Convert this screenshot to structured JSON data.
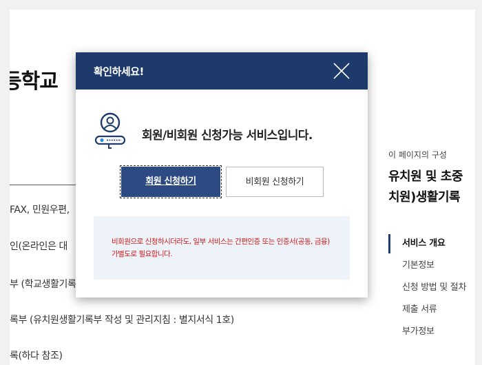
{
  "page": {
    "title": "등학교",
    "content_lines": [
      "FAX, 민원우편,",
      "인(온라인은 대",
      "부 (학교생활기록",
      "록부 (유치원생활기록부 작성 및 관리지침 : 별지서식 1호)",
      "록(하다 참조)"
    ]
  },
  "toc": {
    "caption": "이 페이지의 구성",
    "heading_line1": "유치원 및 초중",
    "heading_line2": "치원)생활기록",
    "items": [
      "서비스 개요",
      "기본정보",
      "신청 방법 및 절차",
      "제출 서류",
      "부가정보"
    ]
  },
  "modal": {
    "title": "확인하세요!",
    "message": "회원/비회원 신청가능 서비스입니다.",
    "member_button": "회원 신청하기",
    "nonmember_button": "비회원 신청하기",
    "notice_line1": "비회원으로 신청하시더라도, 일부 서비스는 간편인증 또는 인증서(공동, 금융)",
    "notice_line2": "가별도로 필요합니다."
  }
}
